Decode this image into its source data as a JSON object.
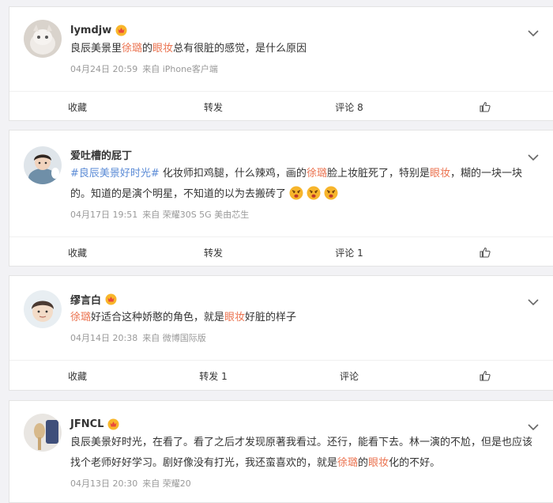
{
  "posts": [
    {
      "username": "lymdjw",
      "text": [
        "良辰美景里",
        "徐璐",
        "的",
        "眼妆",
        "总有很脏的感觉，是什么原因"
      ],
      "meta": {
        "date": "04月24日 20:59",
        "source": "来自 iPhone客户端"
      },
      "actions": {
        "favorite": "收藏",
        "repost": "转发",
        "comment": "评论 8",
        "like_icon": "thumbs-up-icon"
      }
    },
    {
      "username": "爱吐槽的屁丁",
      "text": [
        "#良辰美景好时光#",
        " 化妆师扣鸡腿，什么辣鸡，画的",
        "徐璐",
        "脸上妆脏死了，特别是",
        "眼妆",
        "，糊的一块一块的。知道的是演个明星，不知道的以为去搬砖了"
      ],
      "meta": {
        "date": "04月17日 19:51",
        "source": "来自 荣耀30S 5G 美由芯生"
      },
      "actions": {
        "favorite": "收藏",
        "repost": "转发",
        "comment": "评论 1",
        "like_icon": "thumbs-up-icon"
      }
    },
    {
      "username": "缪言白",
      "text": [
        "徐璐",
        "好适合这种娇憨的角色，就是",
        "眼妆",
        "好脏的样子"
      ],
      "meta": {
        "date": "04月14日 20:38",
        "source": "来自 微博国际版"
      },
      "actions": {
        "favorite": "收藏",
        "repost": "转发 1",
        "comment": "评论",
        "like_icon": "thumbs-up-icon"
      }
    },
    {
      "username": "JFNCL",
      "text": [
        "良辰美景好时光，在看了。看了之后才发现原著我看过。还行，能看下去。林一演的不尬，但是也应该找个老师好好学习。剧好像没有打光，我还蛮喜欢的，就是",
        "徐璐",
        "的",
        "眼妆",
        "化的不好。"
      ],
      "meta": {
        "date": "04月13日 20:30",
        "source": "来自 荣耀20"
      }
    }
  ],
  "colors": {
    "highlight": "#eb7350",
    "topic": "#5b8bd6",
    "meta": "#999999"
  }
}
